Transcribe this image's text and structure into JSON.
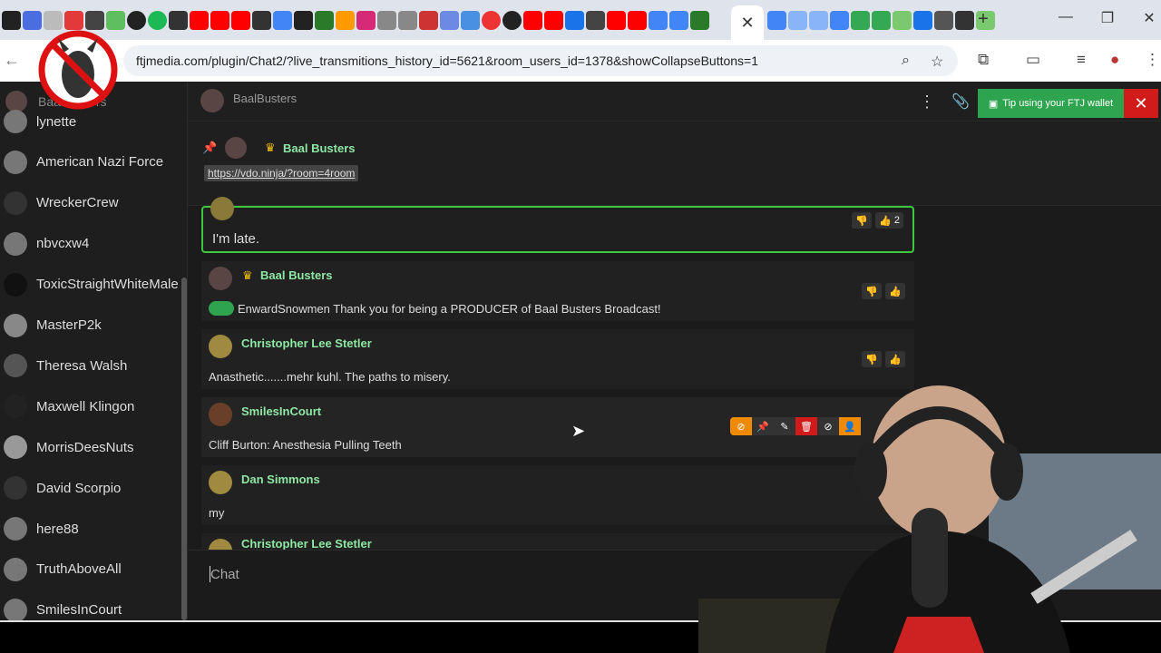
{
  "browser": {
    "url": "ftjmedia.com/plugin/Chat2/?live_transmitions_history_id=5621&room_users_id=1378&showCollapseButtons=1",
    "active_tab_close": "✕",
    "new_tab": "+",
    "window_controls": [
      "—",
      "❐",
      "✕"
    ]
  },
  "sidebar": {
    "top_user": "BaalBusters",
    "items": [
      {
        "name": "lynette",
        "color": "#777"
      },
      {
        "name": "American Nazi Force",
        "color": "#777"
      },
      {
        "name": "WreckerCrew",
        "color": "#333"
      },
      {
        "name": "nbvcxw4",
        "color": "#777"
      },
      {
        "name": "ToxicStraightWhiteMale",
        "color": "#111"
      },
      {
        "name": "MasterP2k",
        "color": "#888"
      },
      {
        "name": "Theresa Walsh",
        "color": "#555"
      },
      {
        "name": "Maxwell Klingon",
        "color": "#222"
      },
      {
        "name": "MorrisDeesNuts",
        "color": "#999"
      },
      {
        "name": "David Scorpio",
        "color": "#333"
      },
      {
        "name": "here88",
        "color": "#777"
      },
      {
        "name": "TruthAboveAll",
        "color": "#777"
      },
      {
        "name": "SmilesInCourt",
        "color": "#777"
      }
    ]
  },
  "header": {
    "room_name": "BaalBusters",
    "tip_label": "Tip using your FTJ wallet"
  },
  "pinned": {
    "author": "Baal Busters",
    "link": "https://vdo.ninja/?room=4room"
  },
  "messages": [
    {
      "text": "I'm late.",
      "likes": "2"
    },
    {
      "author": "Baal Busters",
      "text": "EnwardSnowmen Thank you for being a PRODUCER of Baal Busters Broadcast!"
    },
    {
      "author": "Christopher Lee Stetler",
      "text": "Anasthetic.......mehr kuhl. The paths to misery."
    },
    {
      "author": "SmilesInCourt",
      "text": "Cliff Burton: Anesthesia Pulling Teeth"
    },
    {
      "author": "Dan Simmons",
      "text": "my"
    },
    {
      "author": "Christopher Lee Stetler",
      "text": ""
    }
  ],
  "chat_input": {
    "placeholder": "Chat"
  },
  "colors": {
    "accent_green": "#2ea44f",
    "name_green": "#8ee6a3",
    "danger_red": "#d11a1a"
  }
}
